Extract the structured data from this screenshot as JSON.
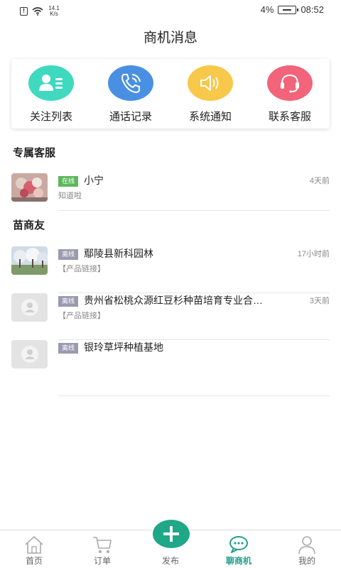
{
  "status_bar": {
    "speed": "14.1 K/s",
    "battery": "4%",
    "time": "08:52"
  },
  "header": {
    "title": "商机消息"
  },
  "quick_actions": [
    {
      "label": "关注列表",
      "icon": "follow-list-icon",
      "color": "#3fd9c0"
    },
    {
      "label": "通话记录",
      "icon": "phone-icon",
      "color": "#4a90e2"
    },
    {
      "label": "系统通知",
      "icon": "speaker-icon",
      "color": "#f7c84a"
    },
    {
      "label": "联系客服",
      "icon": "headset-icon",
      "color": "#f26479"
    }
  ],
  "sections": {
    "exclusive_service": "专属客服",
    "seedling_friends": "苗商友"
  },
  "service_chats": [
    {
      "status": "在线",
      "name": "小宁",
      "time": "4天前",
      "preview": "知道啦"
    }
  ],
  "friend_chats": [
    {
      "status": "离线",
      "name": "鄢陵县新科园林",
      "time": "17小时前",
      "preview": "【产品链接】"
    },
    {
      "status": "离线",
      "name": "贵州省松桃众源红豆杉种苗培育专业合…",
      "time": "3天前",
      "preview": "【产品链接】"
    },
    {
      "status": "离线",
      "name": "银玲草坪种植基地",
      "time": "",
      "preview": ""
    }
  ],
  "tab_bar": {
    "home": "首页",
    "orders": "订单",
    "publish": "发布",
    "chat": "聊商机",
    "mine": "我的",
    "active_color": "#25a08a"
  }
}
